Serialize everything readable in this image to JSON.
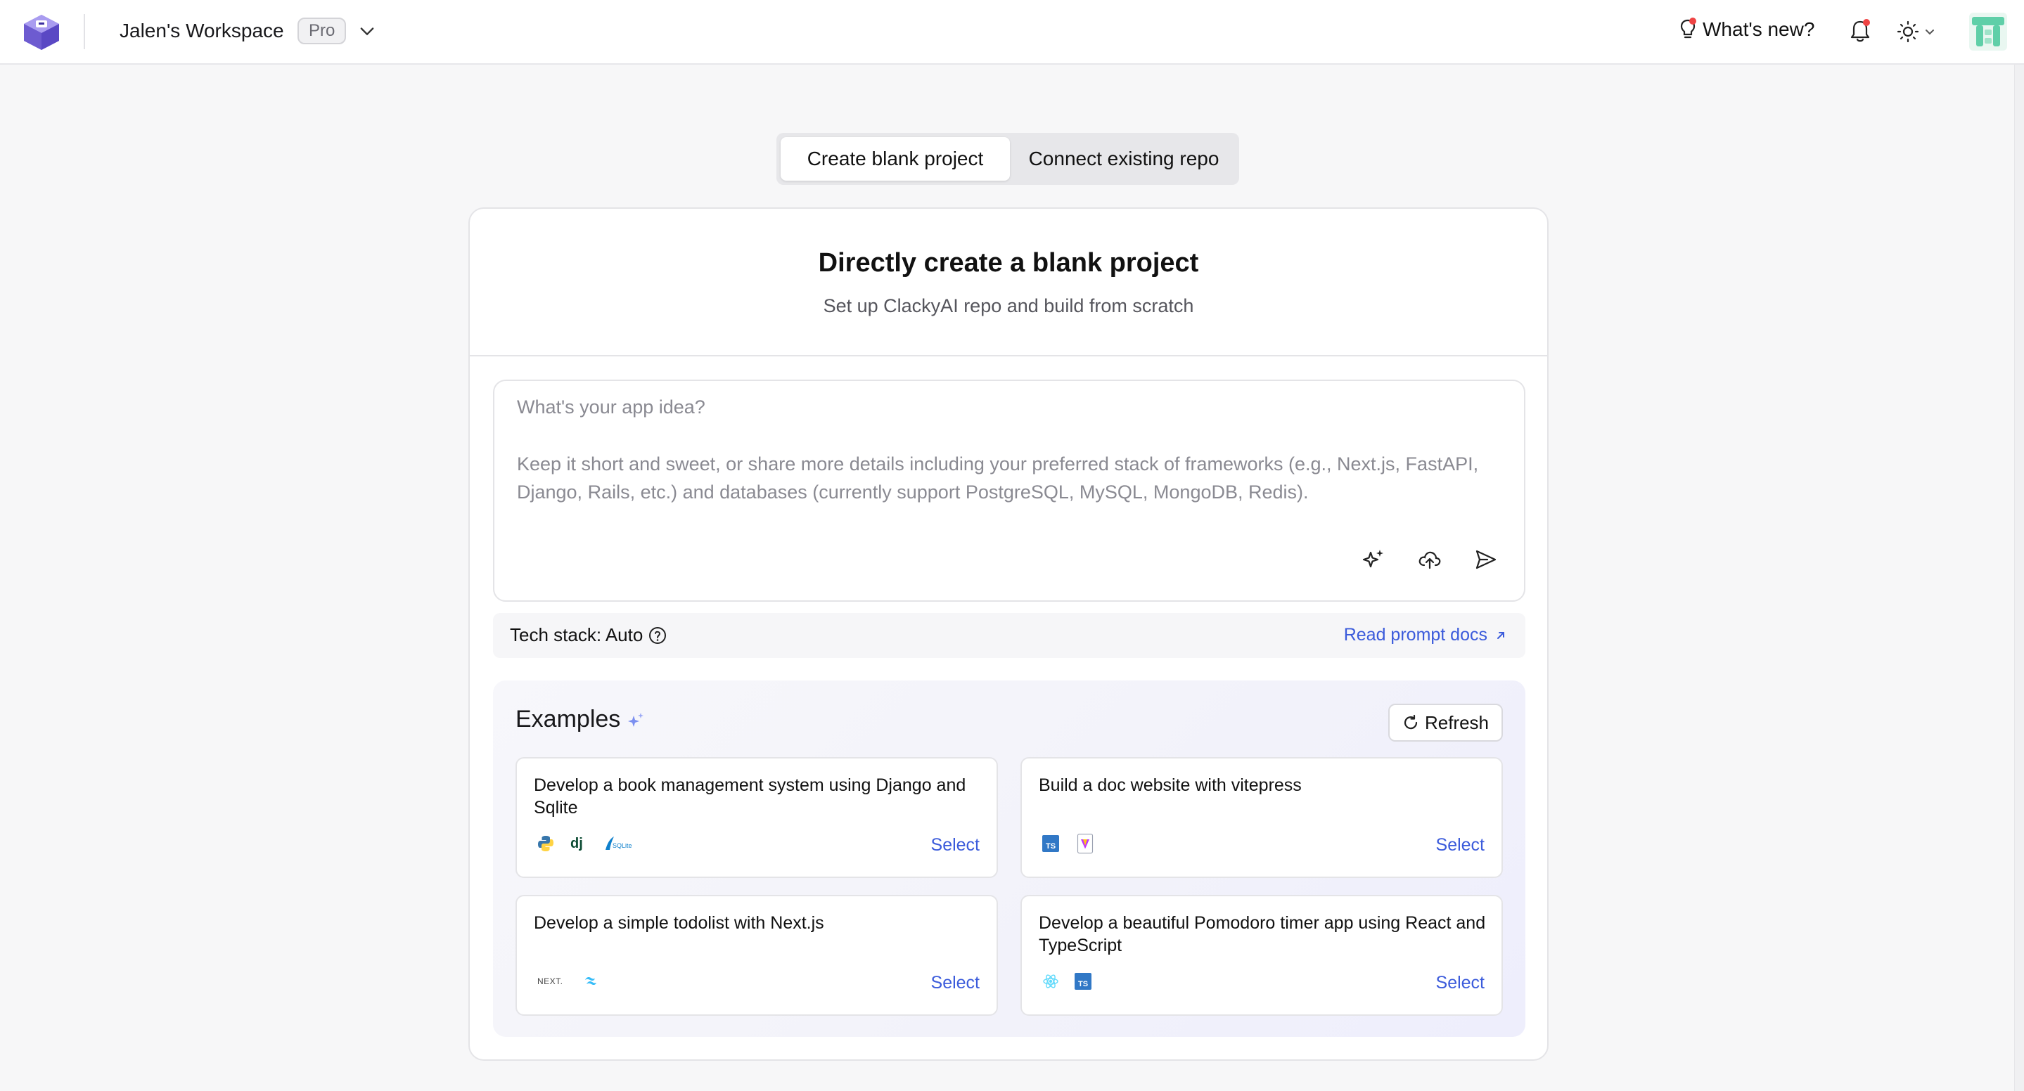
{
  "header": {
    "workspace_name": "Jalen's Workspace",
    "plan_badge": "Pro",
    "whats_new": "What's new?"
  },
  "tabs": [
    {
      "label": "Create blank project",
      "active": true
    },
    {
      "label": "Connect existing repo",
      "active": false
    }
  ],
  "card": {
    "title": "Directly create a blank project",
    "subtitle": "Set up ClackyAI repo and build from scratch"
  },
  "prompt": {
    "title_placeholder": "What's your app idea?",
    "body_placeholder": "Keep it short and sweet, or share more details including your preferred stack of frameworks (e.g., Next.js, FastAPI, Django, Rails, etc.) and databases (currently support PostgreSQL, MySQL, MongoDB, Redis)."
  },
  "tech": {
    "label": "Tech stack: Auto",
    "docs_link": "Read prompt docs"
  },
  "examples": {
    "title": "Examples",
    "refresh_label": "Refresh",
    "items": [
      {
        "text": "Develop a book management system using Django and Sqlite",
        "icons": [
          "python-icon",
          "django-icon",
          "sqlite-icon"
        ],
        "select": "Select"
      },
      {
        "text": "Build a doc website with vitepress",
        "icons": [
          "typescript-icon",
          "vite-icon"
        ],
        "select": "Select"
      },
      {
        "text": "Develop a simple todolist with Next.js",
        "icons": [
          "nextjs-icon",
          "tailwind-icon"
        ],
        "select": "Select"
      },
      {
        "text": "Develop a beautiful Pomodoro timer app using React and TypeScript",
        "icons": [
          "react-icon",
          "typescript-icon"
        ],
        "select": "Select"
      }
    ]
  },
  "colors": {
    "accent_link": "#3b5bdb",
    "notification_dot": "#ef4444",
    "logo_purple": "#6d5bd0",
    "avatar_teal": "#5fcfa8"
  }
}
